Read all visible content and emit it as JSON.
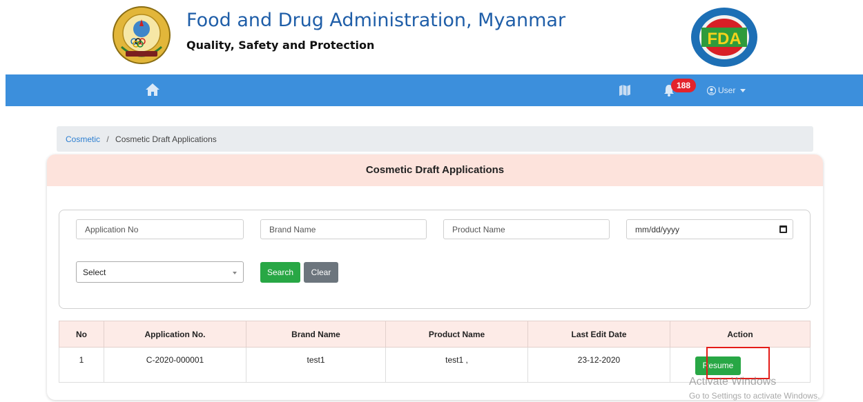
{
  "header": {
    "title": "Food and Drug Administration, Myanmar",
    "subtitle": "Quality, Safety and Protection",
    "left_logo_icon": "ministry-seal-icon",
    "right_logo_icon": "fda-seal-icon",
    "right_logo_text": "FDA"
  },
  "nav": {
    "home_icon": "home-icon",
    "language_icon": "language-icon",
    "bell_icon": "bell-icon",
    "notification_count": "188",
    "user_label": "User",
    "accent_color": "#3c8fdc",
    "badge_color": "#e3232b"
  },
  "breadcrumb": {
    "parent": "Cosmetic",
    "separator": "/",
    "current": "Cosmetic Draft Applications"
  },
  "card": {
    "title": "Cosmetic Draft Applications",
    "header_color": "#fde3dc"
  },
  "filters": {
    "application_no_placeholder": "Application No",
    "brand_name_placeholder": "Brand Name",
    "product_name_placeholder": "Product Name",
    "date_placeholder": "mm/dd/yyyy",
    "select_value": "Select",
    "search_label": "Search",
    "clear_label": "Clear"
  },
  "table": {
    "columns": [
      "No",
      "Application No.",
      "Brand Name",
      "Product Name",
      "Last Edit Date",
      "Action"
    ],
    "rows": [
      {
        "no": "1",
        "application_no": "C-2020-000001",
        "brand_name": "test1",
        "product_name": "test1 ,",
        "last_edit_date": "23-12-2020",
        "action_label": "Resume"
      }
    ]
  },
  "watermark": {
    "line1": "Activate Windows",
    "line2": "Go to Settings to activate Windows."
  },
  "colors": {
    "success": "#28a745",
    "secondary": "#6c757d",
    "highlight": "#e41b17"
  }
}
